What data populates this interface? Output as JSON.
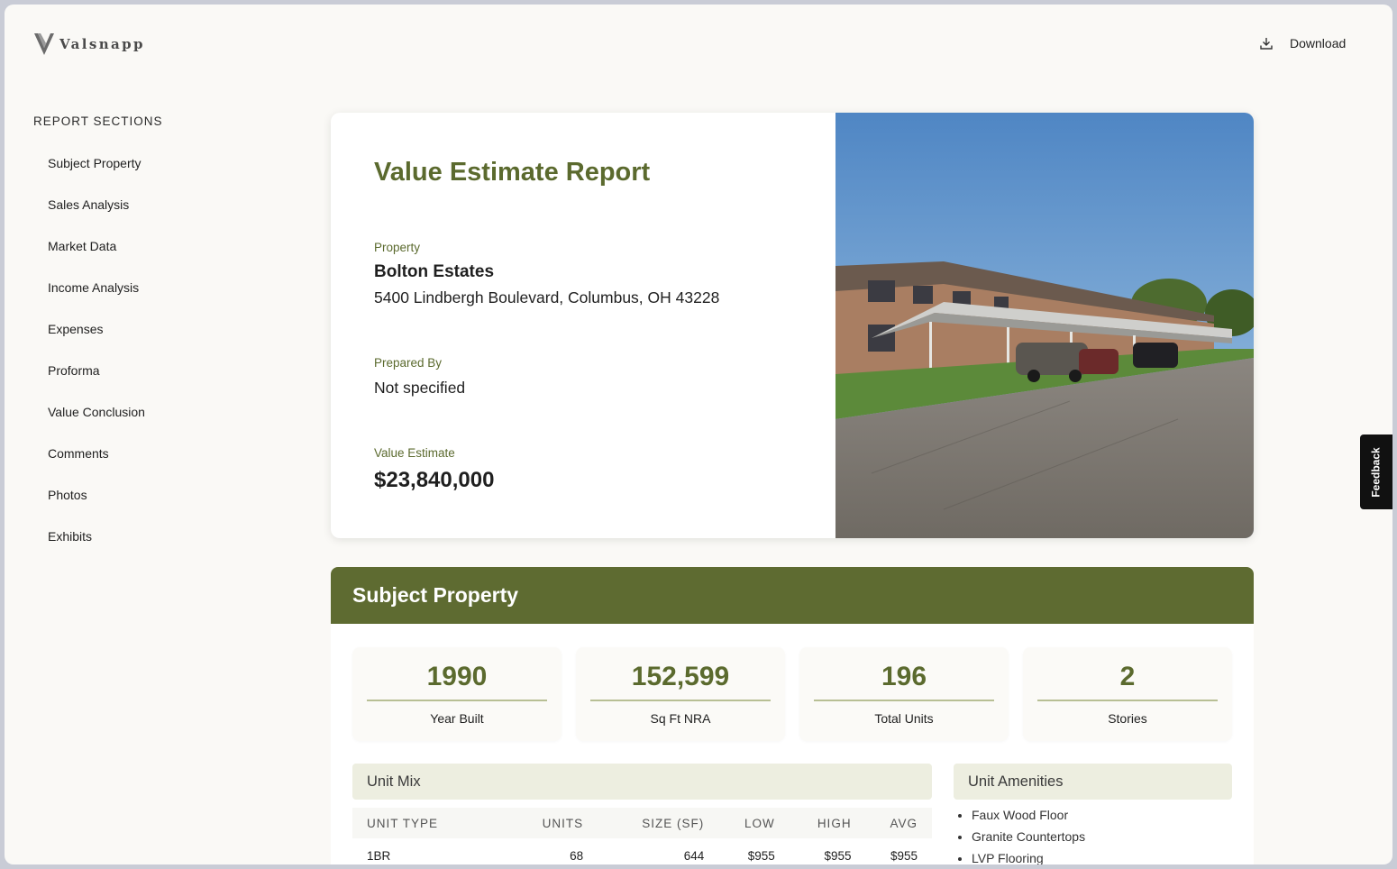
{
  "header": {
    "brand": "Valsnapp",
    "download_label": "Download"
  },
  "sidebar": {
    "heading": "REPORT SECTIONS",
    "items": [
      "Subject Property",
      "Sales Analysis",
      "Market Data",
      "Income Analysis",
      "Expenses",
      "Proforma",
      "Value Conclusion",
      "Comments",
      "Photos",
      "Exhibits"
    ]
  },
  "hero": {
    "title": "Value Estimate Report",
    "property_label": "Property",
    "property_name": "Bolton Estates",
    "property_address": "5400 Lindbergh Boulevard, Columbus, OH 43228",
    "prepared_by_label": "Prepared By",
    "prepared_by_value": "Not specified",
    "value_estimate_label": "Value Estimate",
    "value_estimate_value": "$23,840,000"
  },
  "subject_property": {
    "title": "Subject Property",
    "stats": [
      {
        "value": "1990",
        "label": "Year Built"
      },
      {
        "value": "152,599",
        "label": "Sq Ft NRA"
      },
      {
        "value": "196",
        "label": "Total Units"
      },
      {
        "value": "2",
        "label": "Stories"
      }
    ],
    "unit_mix": {
      "title": "Unit Mix",
      "columns": [
        "UNIT TYPE",
        "UNITS",
        "SIZE (SF)",
        "LOW",
        "HIGH",
        "AVG"
      ],
      "rows": [
        [
          "1BR",
          "68",
          "644",
          "$955",
          "$955",
          "$955"
        ]
      ]
    },
    "unit_amenities": {
      "title": "Unit Amenities",
      "items": [
        "Faux Wood Floor",
        "Granite Countertops",
        "LVP Flooring"
      ]
    }
  },
  "feedback_label": "Feedback",
  "colors": {
    "brand_green": "#5e6b31",
    "accent_text": "#5b6a2e",
    "panel_bg": "#edeee0",
    "page_bg": "#faf9f6"
  }
}
